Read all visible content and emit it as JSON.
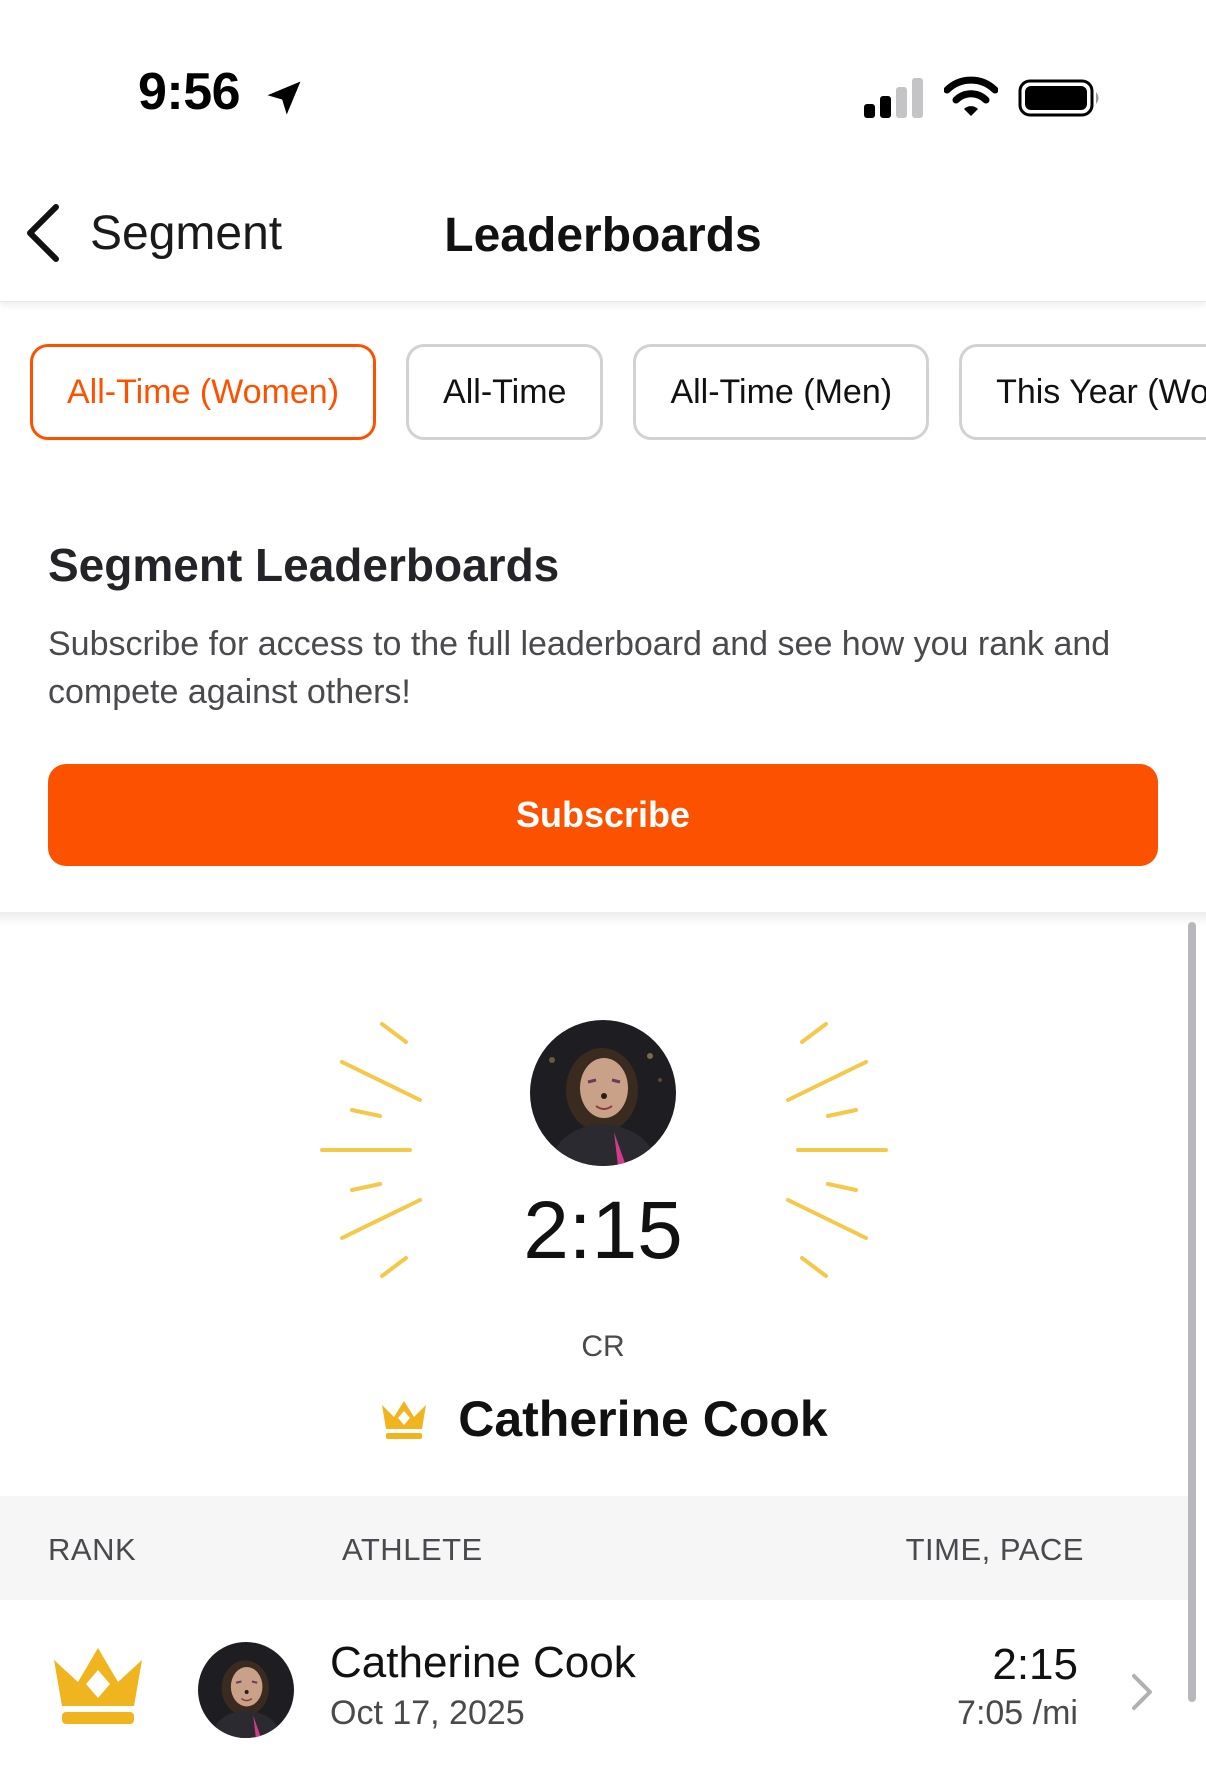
{
  "status_bar": {
    "time": "9:56",
    "icons": [
      "location-arrow-icon",
      "cellular-signal-icon",
      "wifi-icon",
      "battery-icon"
    ]
  },
  "nav": {
    "back_label": "Segment",
    "title": "Leaderboards"
  },
  "filters": [
    {
      "label": "All-Time (Women)",
      "active": true
    },
    {
      "label": "All-Time",
      "active": false
    },
    {
      "label": "All-Time (Men)",
      "active": false
    },
    {
      "label": "This Year (Wo",
      "active": false
    }
  ],
  "subscribe": {
    "title": "Segment Leaderboards",
    "description": "Subscribe for access to the full leaderboard and see how you rank and compete against others!",
    "button_label": "Subscribe"
  },
  "cr": {
    "time": "2:15",
    "label": "CR",
    "holder_name": "Catherine Cook"
  },
  "table": {
    "headers": {
      "rank": "RANK",
      "athlete": "ATHLETE",
      "time_pace": "TIME, PACE"
    },
    "rows": [
      {
        "rank_icon": "crown-icon",
        "name": "Catherine Cook",
        "date": "Oct 17, 2025",
        "time": "2:15",
        "pace": "7:05 /mi"
      }
    ]
  },
  "colors": {
    "accent": "#fc5200",
    "crown": "#f0b41e",
    "text": "#242428"
  }
}
